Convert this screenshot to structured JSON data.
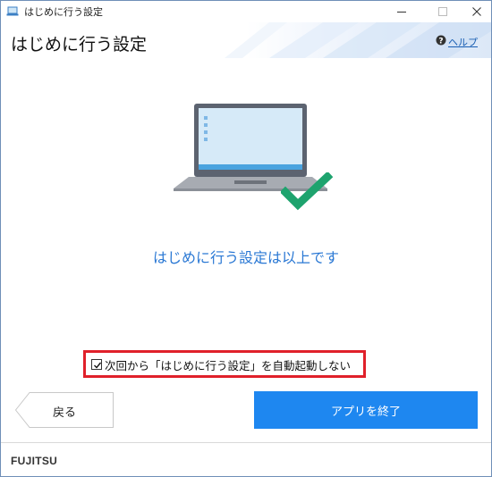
{
  "window": {
    "title": "はじめに行う設定",
    "controls": [
      "minimize-icon",
      "maximize-icon",
      "close-icon"
    ]
  },
  "header": {
    "title": "はじめに行う設定",
    "help_label": "ヘルプ",
    "help_icon": "help-question-icon"
  },
  "illustration": {
    "laptop_icon": "laptop-icon",
    "check_icon": "checkmark-icon",
    "check_color": "#1ea36e"
  },
  "main": {
    "message": "はじめに行う設定は以上です",
    "message_color": "#2a78d4"
  },
  "option": {
    "checked": true,
    "label": "次回から「はじめに行う設定」を自動起動しない",
    "highlight_color": "#e0202a"
  },
  "buttons": {
    "back_label": "戻る",
    "finish_label": "アプリを終了",
    "finish_color": "#1e87f0"
  },
  "footer": {
    "logo_text": "FUJITSU"
  }
}
